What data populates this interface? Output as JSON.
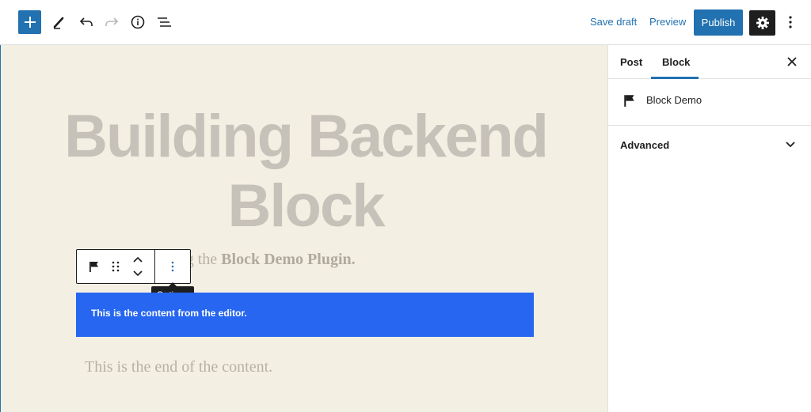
{
  "toolbar": {
    "save_draft_label": "Save draft",
    "preview_label": "Preview",
    "publish_label": "Publish"
  },
  "canvas": {
    "title_line1": "Building Backend",
    "title_line2": "Block",
    "para1_prefix": "fically for testing the",
    "para1_bold": "Block Demo Plugin.",
    "block_content": "This is the content from the editor.",
    "para2": "This is the end of the content.",
    "tooltip": "Options"
  },
  "sidebar": {
    "tabs": [
      {
        "label": "Post"
      },
      {
        "label": "Block"
      }
    ],
    "block_name": "Block Demo",
    "panel_label": "Advanced"
  },
  "colors": {
    "accent": "#2271b1",
    "block_background": "#2666f0",
    "canvas_background": "#f4efe3"
  },
  "icons": [
    "plus-icon",
    "pen-icon",
    "undo-icon",
    "redo-icon",
    "info-icon",
    "list-view-icon",
    "gear-icon",
    "more-vertical-icon",
    "flag-icon",
    "drag-handle-icon",
    "move-up-icon",
    "move-down-icon",
    "close-icon",
    "chevron-down-icon"
  ]
}
